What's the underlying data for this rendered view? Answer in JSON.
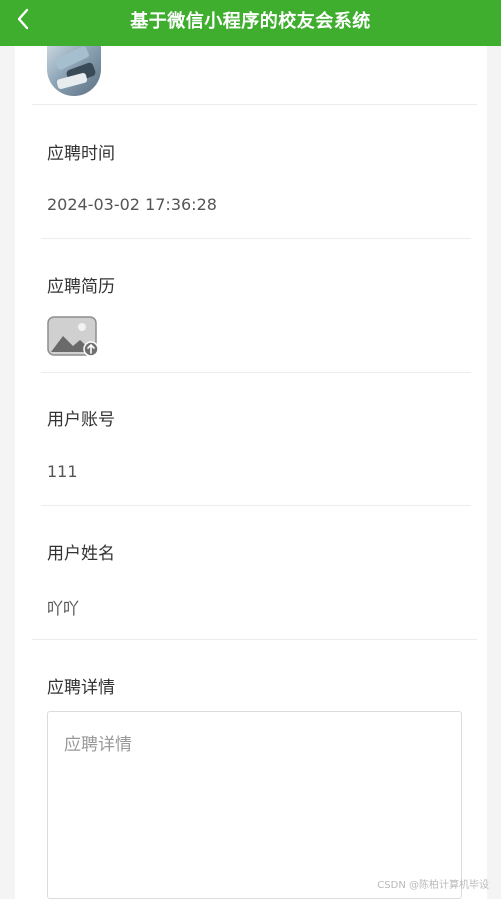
{
  "header": {
    "title": "基于微信小程序的校友会系统",
    "back_icon": "chevron-left-icon",
    "background": "#3fae2f"
  },
  "profile": {
    "avatar_icon": "avatar-photo"
  },
  "fields": {
    "apply_time": {
      "label": "应聘时间",
      "value": "2024-03-02 17:36:28"
    },
    "resume": {
      "label": "应聘简历",
      "icon": "image-upload-icon"
    },
    "user_account": {
      "label": "用户账号",
      "value": "111"
    },
    "user_name": {
      "label": "用户姓名",
      "value": "吖吖"
    },
    "apply_details": {
      "label": "应聘详情",
      "placeholder": "应聘详情",
      "value": ""
    }
  },
  "watermark": "CSDN @陈柏计算机毕设"
}
